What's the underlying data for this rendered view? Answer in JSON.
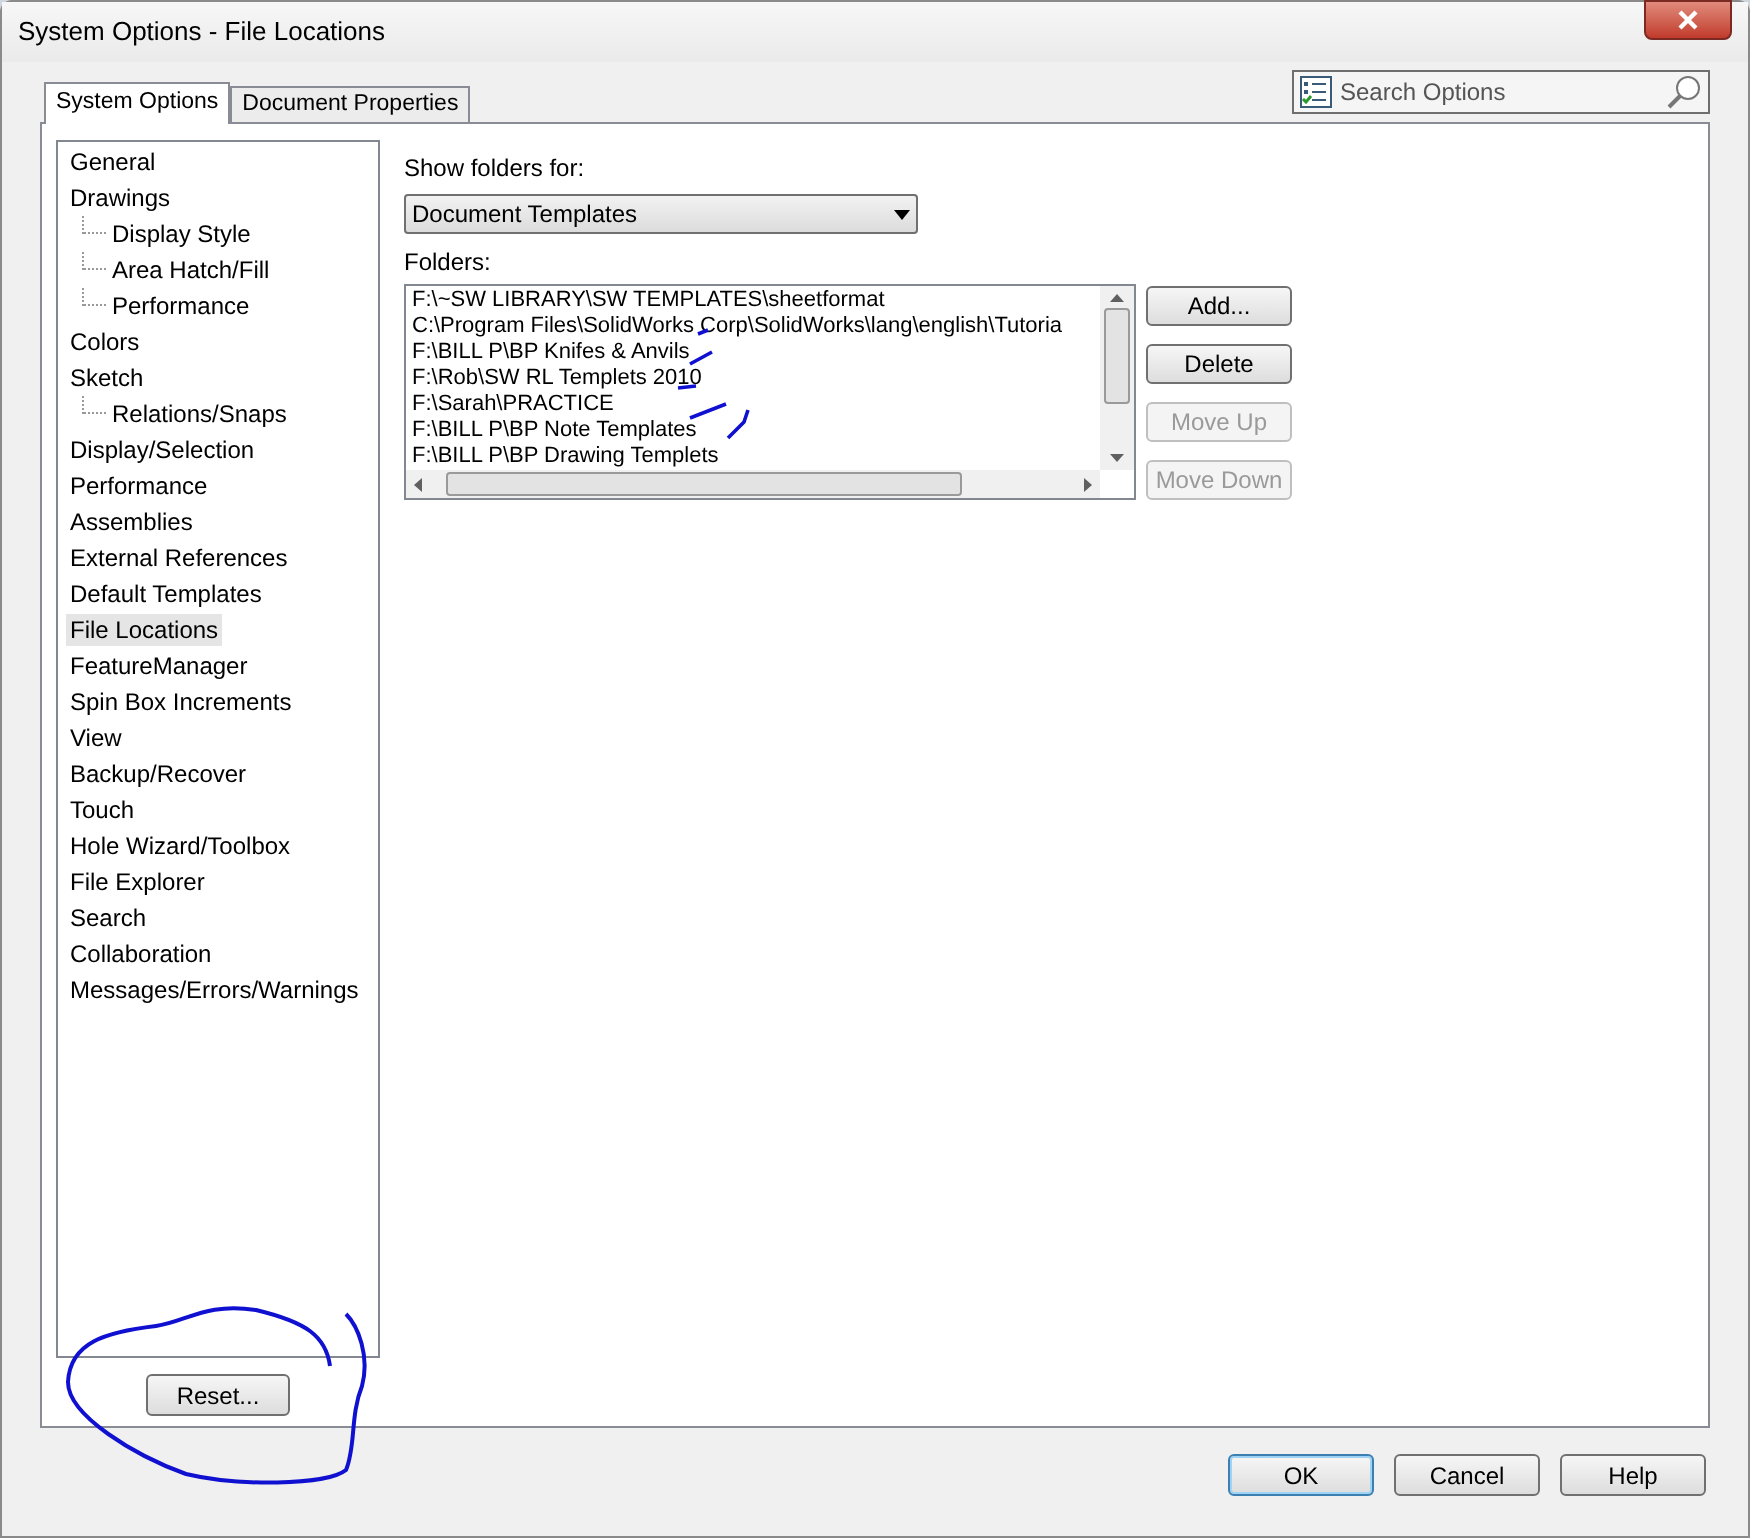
{
  "window": {
    "title": "System Options - File Locations"
  },
  "tabs": [
    {
      "label": "System Options",
      "selected": true
    },
    {
      "label": "Document Properties",
      "selected": false
    }
  ],
  "search": {
    "placeholder": "Search Options"
  },
  "tree": [
    {
      "label": "General",
      "selected": false
    },
    {
      "label": "Drawings",
      "selected": false,
      "children": [
        {
          "label": "Display Style",
          "selected": false
        },
        {
          "label": "Area Hatch/Fill",
          "selected": false
        },
        {
          "label": "Performance",
          "selected": false
        }
      ]
    },
    {
      "label": "Colors",
      "selected": false
    },
    {
      "label": "Sketch",
      "selected": false,
      "children": [
        {
          "label": "Relations/Snaps",
          "selected": false
        }
      ]
    },
    {
      "label": "Display/Selection",
      "selected": false
    },
    {
      "label": "Performance",
      "selected": false
    },
    {
      "label": "Assemblies",
      "selected": false
    },
    {
      "label": "External References",
      "selected": false
    },
    {
      "label": "Default Templates",
      "selected": false
    },
    {
      "label": "File Locations",
      "selected": true
    },
    {
      "label": "FeatureManager",
      "selected": false
    },
    {
      "label": "Spin Box Increments",
      "selected": false
    },
    {
      "label": "View",
      "selected": false
    },
    {
      "label": "Backup/Recover",
      "selected": false
    },
    {
      "label": "Touch",
      "selected": false
    },
    {
      "label": "Hole Wizard/Toolbox",
      "selected": false
    },
    {
      "label": "File Explorer",
      "selected": false
    },
    {
      "label": "Search",
      "selected": false
    },
    {
      "label": "Collaboration",
      "selected": false
    },
    {
      "label": "Messages/Errors/Warnings",
      "selected": false
    }
  ],
  "reset_button": "Reset...",
  "show_folders_for": {
    "label": "Show folders for:",
    "value": "Document Templates"
  },
  "folders": {
    "label": "Folders:",
    "items": [
      "F:\\~SW LIBRARY\\SW TEMPLATES\\sheetformat",
      "C:\\Program Files\\SolidWorks Corp\\SolidWorks\\lang\\english\\Tutoria",
      "F:\\BILL P\\BP Knifes & Anvils",
      "F:\\Rob\\SW RL Templets 2010",
      "F:\\Sarah\\PRACTICE",
      "F:\\BILL P\\BP Note Templates",
      "F:\\BILL P\\BP Drawing Templets"
    ]
  },
  "folder_buttons": [
    {
      "label": "Add...",
      "disabled": false
    },
    {
      "label": "Delete",
      "disabled": false
    },
    {
      "label": "Move Up",
      "disabled": true
    },
    {
      "label": "Move Down",
      "disabled": true
    }
  ],
  "dialog_buttons": [
    {
      "label": "OK",
      "default": true
    },
    {
      "label": "Cancel",
      "default": false
    },
    {
      "label": "Help",
      "default": false
    }
  ]
}
